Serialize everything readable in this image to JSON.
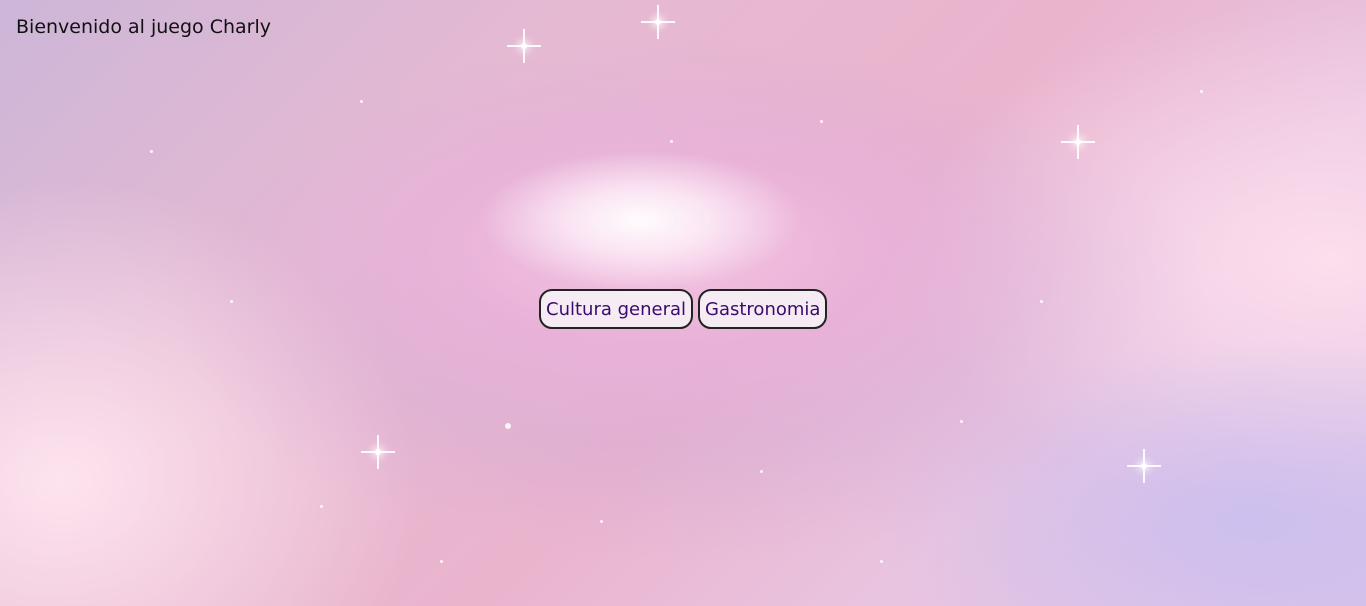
{
  "page": {
    "welcome_text": "Bienvenido al juego Charly"
  },
  "menu": {
    "buttons": [
      {
        "label": "Cultura general"
      },
      {
        "label": "Gastronomia"
      }
    ]
  },
  "colors": {
    "button_text": "#3a0a6e",
    "button_border": "#222222",
    "button_bg": "#f5f0f5",
    "welcome_text": "#111111"
  }
}
